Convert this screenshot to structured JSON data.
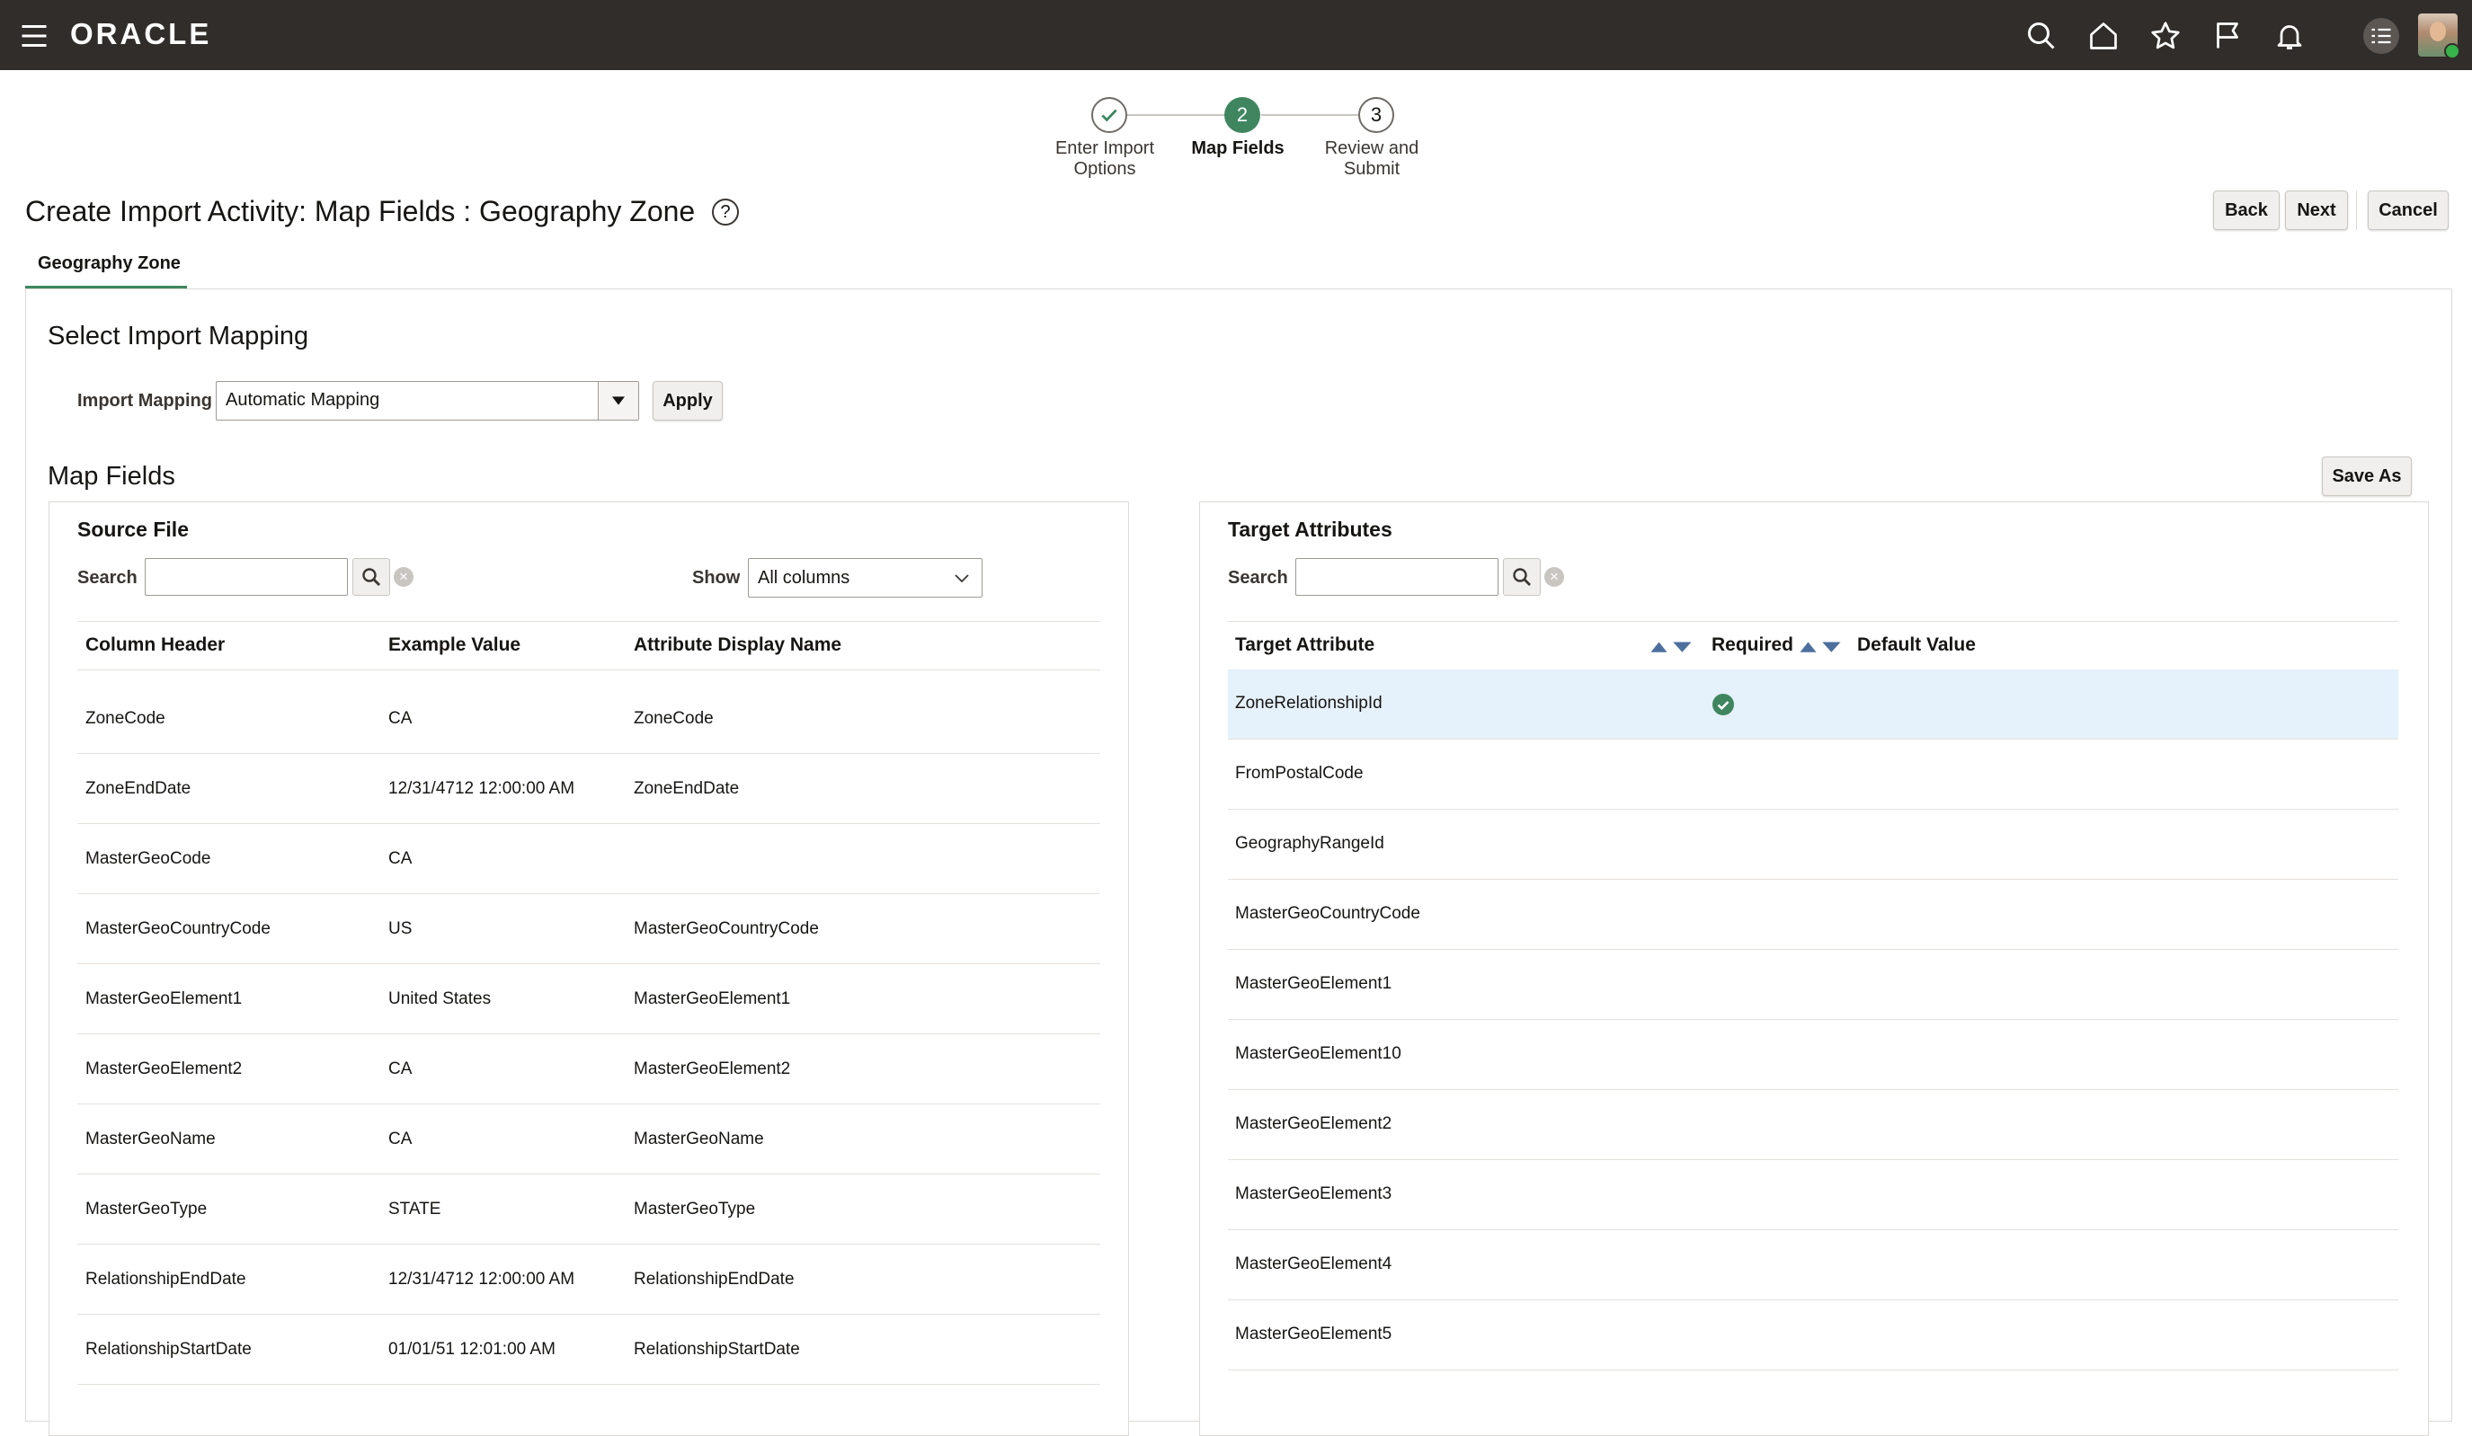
{
  "header": {
    "brand": "ORACLE",
    "icons": [
      "menu-icon",
      "search-icon",
      "home-icon",
      "favorites-star-icon",
      "flag-icon",
      "notifications-bell-icon",
      "tasks-icon",
      "user-avatar"
    ]
  },
  "train": {
    "steps": [
      {
        "label_line1": "Enter Import",
        "label_line2": "Options",
        "marker": "",
        "state": "completed"
      },
      {
        "label_line1": "Map Fields",
        "label_line2": "",
        "marker": "2",
        "state": "current"
      },
      {
        "label_line1": "Review and",
        "label_line2": "Submit",
        "marker": "3",
        "state": "upcoming"
      }
    ]
  },
  "page": {
    "title": "Create Import Activity: Map Fields : Geography Zone",
    "buttons": {
      "back": "Back",
      "next": "Next",
      "cancel": "Cancel"
    },
    "tab": "Geography Zone"
  },
  "select_mapping": {
    "title": "Select Import Mapping",
    "label": "Import Mapping",
    "value": "Automatic Mapping",
    "apply": "Apply"
  },
  "map_fields": {
    "title": "Map Fields",
    "save_as": "Save As"
  },
  "source": {
    "title": "Source File",
    "search_label": "Search",
    "search_value": "",
    "show_label": "Show",
    "show_value": "All columns",
    "columns": [
      "Column Header",
      "Example Value",
      "Attribute Display Name"
    ],
    "rows": [
      [
        "ZoneCode",
        "CA",
        "ZoneCode"
      ],
      [
        "ZoneEndDate",
        "12/31/4712 12:00:00 AM",
        "ZoneEndDate"
      ],
      [
        "MasterGeoCode",
        "CA",
        ""
      ],
      [
        "MasterGeoCountryCode",
        "US",
        "MasterGeoCountryCode"
      ],
      [
        "MasterGeoElement1",
        "United States",
        "MasterGeoElement1"
      ],
      [
        "MasterGeoElement2",
        "CA",
        "MasterGeoElement2"
      ],
      [
        "MasterGeoName",
        "CA",
        "MasterGeoName"
      ],
      [
        "MasterGeoType",
        "STATE",
        "MasterGeoType"
      ],
      [
        "RelationshipEndDate",
        "12/31/4712 12:00:00 AM",
        "RelationshipEndDate"
      ],
      [
        "RelationshipStartDate",
        "01/01/51 12:01:00 AM",
        "RelationshipStartDate"
      ]
    ]
  },
  "target": {
    "title": "Target Attributes",
    "search_label": "Search",
    "search_value": "",
    "columns": [
      "Target Attribute",
      "Required",
      "Default Value"
    ],
    "rows": [
      {
        "name": "ZoneRelationshipId",
        "required": true,
        "selected": true
      },
      {
        "name": "FromPostalCode",
        "required": false,
        "selected": false
      },
      {
        "name": "GeographyRangeId",
        "required": false,
        "selected": false
      },
      {
        "name": "MasterGeoCountryCode",
        "required": false,
        "selected": false
      },
      {
        "name": "MasterGeoElement1",
        "required": false,
        "selected": false
      },
      {
        "name": "MasterGeoElement10",
        "required": false,
        "selected": false
      },
      {
        "name": "MasterGeoElement2",
        "required": false,
        "selected": false
      },
      {
        "name": "MasterGeoElement3",
        "required": false,
        "selected": false
      },
      {
        "name": "MasterGeoElement4",
        "required": false,
        "selected": false
      },
      {
        "name": "MasterGeoElement5",
        "required": false,
        "selected": false
      }
    ]
  },
  "colors": {
    "topbar": "#312d2a",
    "accent_green": "#3f8660",
    "selected_row": "#e5f1fb",
    "sort_arrow": "#4c6f9e"
  }
}
